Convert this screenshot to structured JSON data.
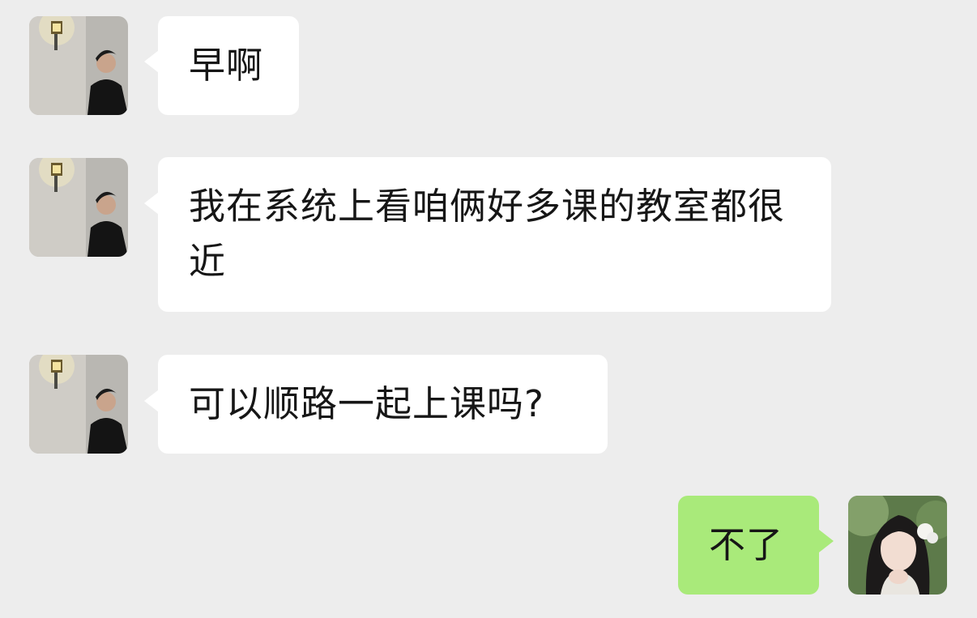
{
  "messages": [
    {
      "sender": "other",
      "text": "早啊"
    },
    {
      "sender": "other",
      "text": "我在系统上看咱俩好多课的教室都很近"
    },
    {
      "sender": "other",
      "text": "可以顺路一起上课吗?"
    },
    {
      "sender": "self",
      "text": "不了"
    }
  ],
  "colors": {
    "background": "#ededed",
    "incoming_bubble": "#ffffff",
    "outgoing_bubble": "#a9ea7a"
  },
  "icons": {
    "other_avatar": "young-man-with-wall-lamp-avatar-icon",
    "self_avatar": "young-woman-with-flower-avatar-icon"
  }
}
